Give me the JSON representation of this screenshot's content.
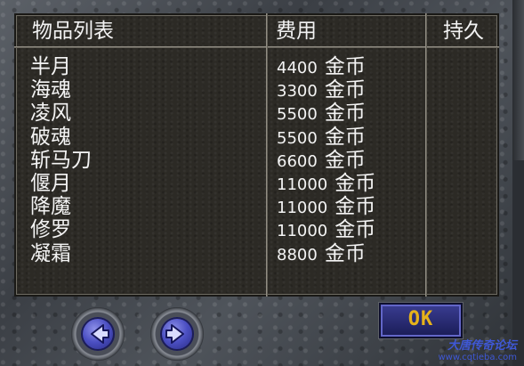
{
  "headers": {
    "item_list": "物品列表",
    "cost": "费用",
    "durability": "持久"
  },
  "items": [
    {
      "name": "半月",
      "cost": "4400",
      "currency": "金币"
    },
    {
      "name": "海魂",
      "cost": "3300",
      "currency": "金币"
    },
    {
      "name": "凌风",
      "cost": "5500",
      "currency": "金币"
    },
    {
      "name": "破魂",
      "cost": "5500",
      "currency": "金币"
    },
    {
      "name": "斩马刀",
      "cost": "6600",
      "currency": "金币"
    },
    {
      "name": "偃月",
      "cost": "11000",
      "currency": "金币"
    },
    {
      "name": "降魔",
      "cost": "11000",
      "currency": "金币"
    },
    {
      "name": "修罗",
      "cost": "11000",
      "currency": "金币"
    },
    {
      "name": "凝霜",
      "cost": "8800",
      "currency": "金币"
    }
  ],
  "buttons": {
    "prev_icon": "arrow-left-icon",
    "next_icon": "arrow-right-icon",
    "ok_label": "OK"
  },
  "watermark": {
    "title": "大唐传奇论坛",
    "url": "www.cqtieba.com"
  }
}
